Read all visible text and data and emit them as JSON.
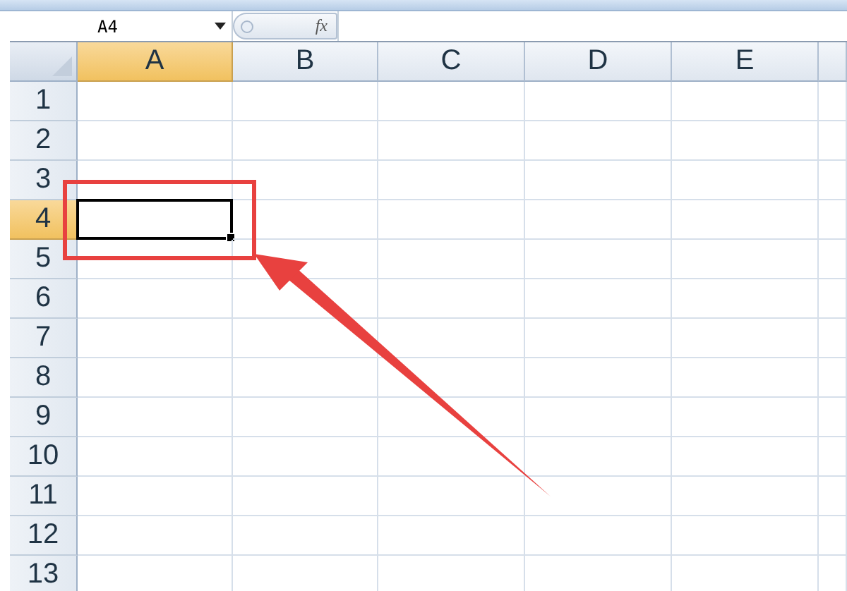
{
  "formula_bar": {
    "name_box": "A4",
    "function_label": "fx"
  },
  "columns": [
    {
      "label": "A",
      "selected": true
    },
    {
      "label": "B",
      "selected": false
    },
    {
      "label": "C",
      "selected": false
    },
    {
      "label": "D",
      "selected": false
    },
    {
      "label": "E",
      "selected": false
    }
  ],
  "rows": [
    {
      "label": "1",
      "selected": false
    },
    {
      "label": "2",
      "selected": false
    },
    {
      "label": "3",
      "selected": false
    },
    {
      "label": "4",
      "selected": true
    },
    {
      "label": "5",
      "selected": false
    },
    {
      "label": "6",
      "selected": false
    },
    {
      "label": "7",
      "selected": false
    },
    {
      "label": "8",
      "selected": false
    },
    {
      "label": "9",
      "selected": false
    },
    {
      "label": "10",
      "selected": false
    },
    {
      "label": "11",
      "selected": false
    },
    {
      "label": "12",
      "selected": false
    },
    {
      "label": "13",
      "selected": false
    }
  ]
}
